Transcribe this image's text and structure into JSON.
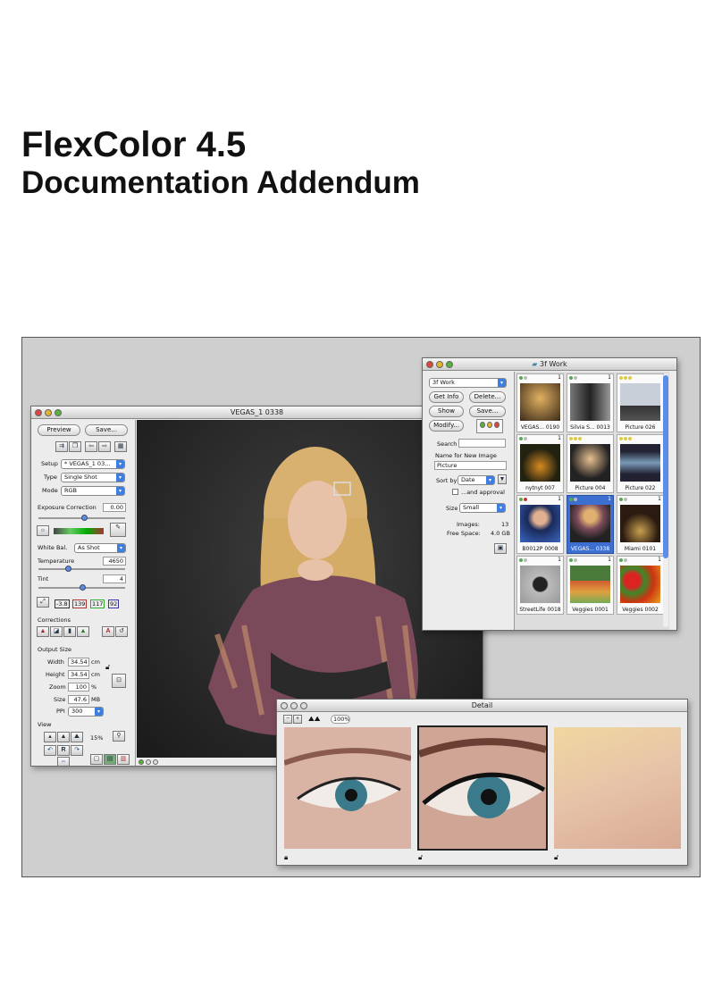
{
  "document": {
    "title": "FlexColor 4.5",
    "subtitle": "Documentation Addendum"
  },
  "main_window": {
    "title": "VEGAS_1  0338",
    "preview_label": "Preview",
    "save_label": "Save...",
    "setup_label": "Setup",
    "setup_value": "* VEGAS_1  03...",
    "type_label": "Type",
    "type_value": "Single Shot",
    "mode_label": "Mode",
    "mode_value": "RGB",
    "exposure_label": "Exposure Correction",
    "exposure_value": "0.00",
    "white_bal_label": "White Bal.",
    "white_bal_value": "As Shot",
    "temperature_label": "Temperature",
    "temperature_value": "4650",
    "tint_label": "Tint",
    "tint_value": "4",
    "levels": [
      "-3.8",
      "139",
      "117",
      "92"
    ],
    "corrections_label": "Corrections",
    "output_size_label": "Output Size",
    "width_label": "Width",
    "width_value": "34.54",
    "width_unit": "cm",
    "height_label": "Height",
    "height_value": "34.54",
    "height_unit": "cm",
    "zoom_label": "Zoom",
    "zoom_value": "100",
    "zoom_unit": "%",
    "size_label": "Size",
    "size_value": "47.6",
    "size_unit": "MB",
    "ppi_label": "PPI",
    "ppi_value": "300",
    "view_label": "View",
    "view_zoom": "15%"
  },
  "browser_window": {
    "title": "3f Work",
    "folder_value": "3f Work",
    "get_info_label": "Get Info",
    "delete_label": "Delete...",
    "show_label": "Show",
    "save_label": "Save...",
    "modify_label": "Modify...",
    "search_label": "Search",
    "name_new_image_label": "Name for New Image",
    "name_new_image_value": "Picture",
    "sort_by_label": "Sort by",
    "sort_by_value": "Date",
    "and_approval_label": "...and approval",
    "size_label": "Size",
    "size_value": "Small",
    "images_label": "Images:",
    "images_value": "13",
    "free_space_label": "Free Space:",
    "free_space_value": "4.0 GB",
    "thumbnails": [
      {
        "caption": "VEGAS... 0190",
        "num": "1"
      },
      {
        "caption": "Silvia S... 0013",
        "num": "1"
      },
      {
        "caption": "Picture 026",
        "num": ""
      },
      {
        "caption": "nytnyt 007",
        "num": "1"
      },
      {
        "caption": "Picture 004",
        "num": ""
      },
      {
        "caption": "Picture 022",
        "num": ""
      },
      {
        "caption": "B0012P 0008",
        "num": "1"
      },
      {
        "caption": "VEGAS... 0338",
        "num": "1"
      },
      {
        "caption": "Miami 0101",
        "num": "1"
      },
      {
        "caption": "StreetLife 0018",
        "num": "1"
      },
      {
        "caption": "Veggies 0001",
        "num": "1"
      },
      {
        "caption": "Veggies 0002",
        "num": "1"
      }
    ]
  },
  "detail_window": {
    "title": "Detail",
    "zoom_value": "100%"
  }
}
